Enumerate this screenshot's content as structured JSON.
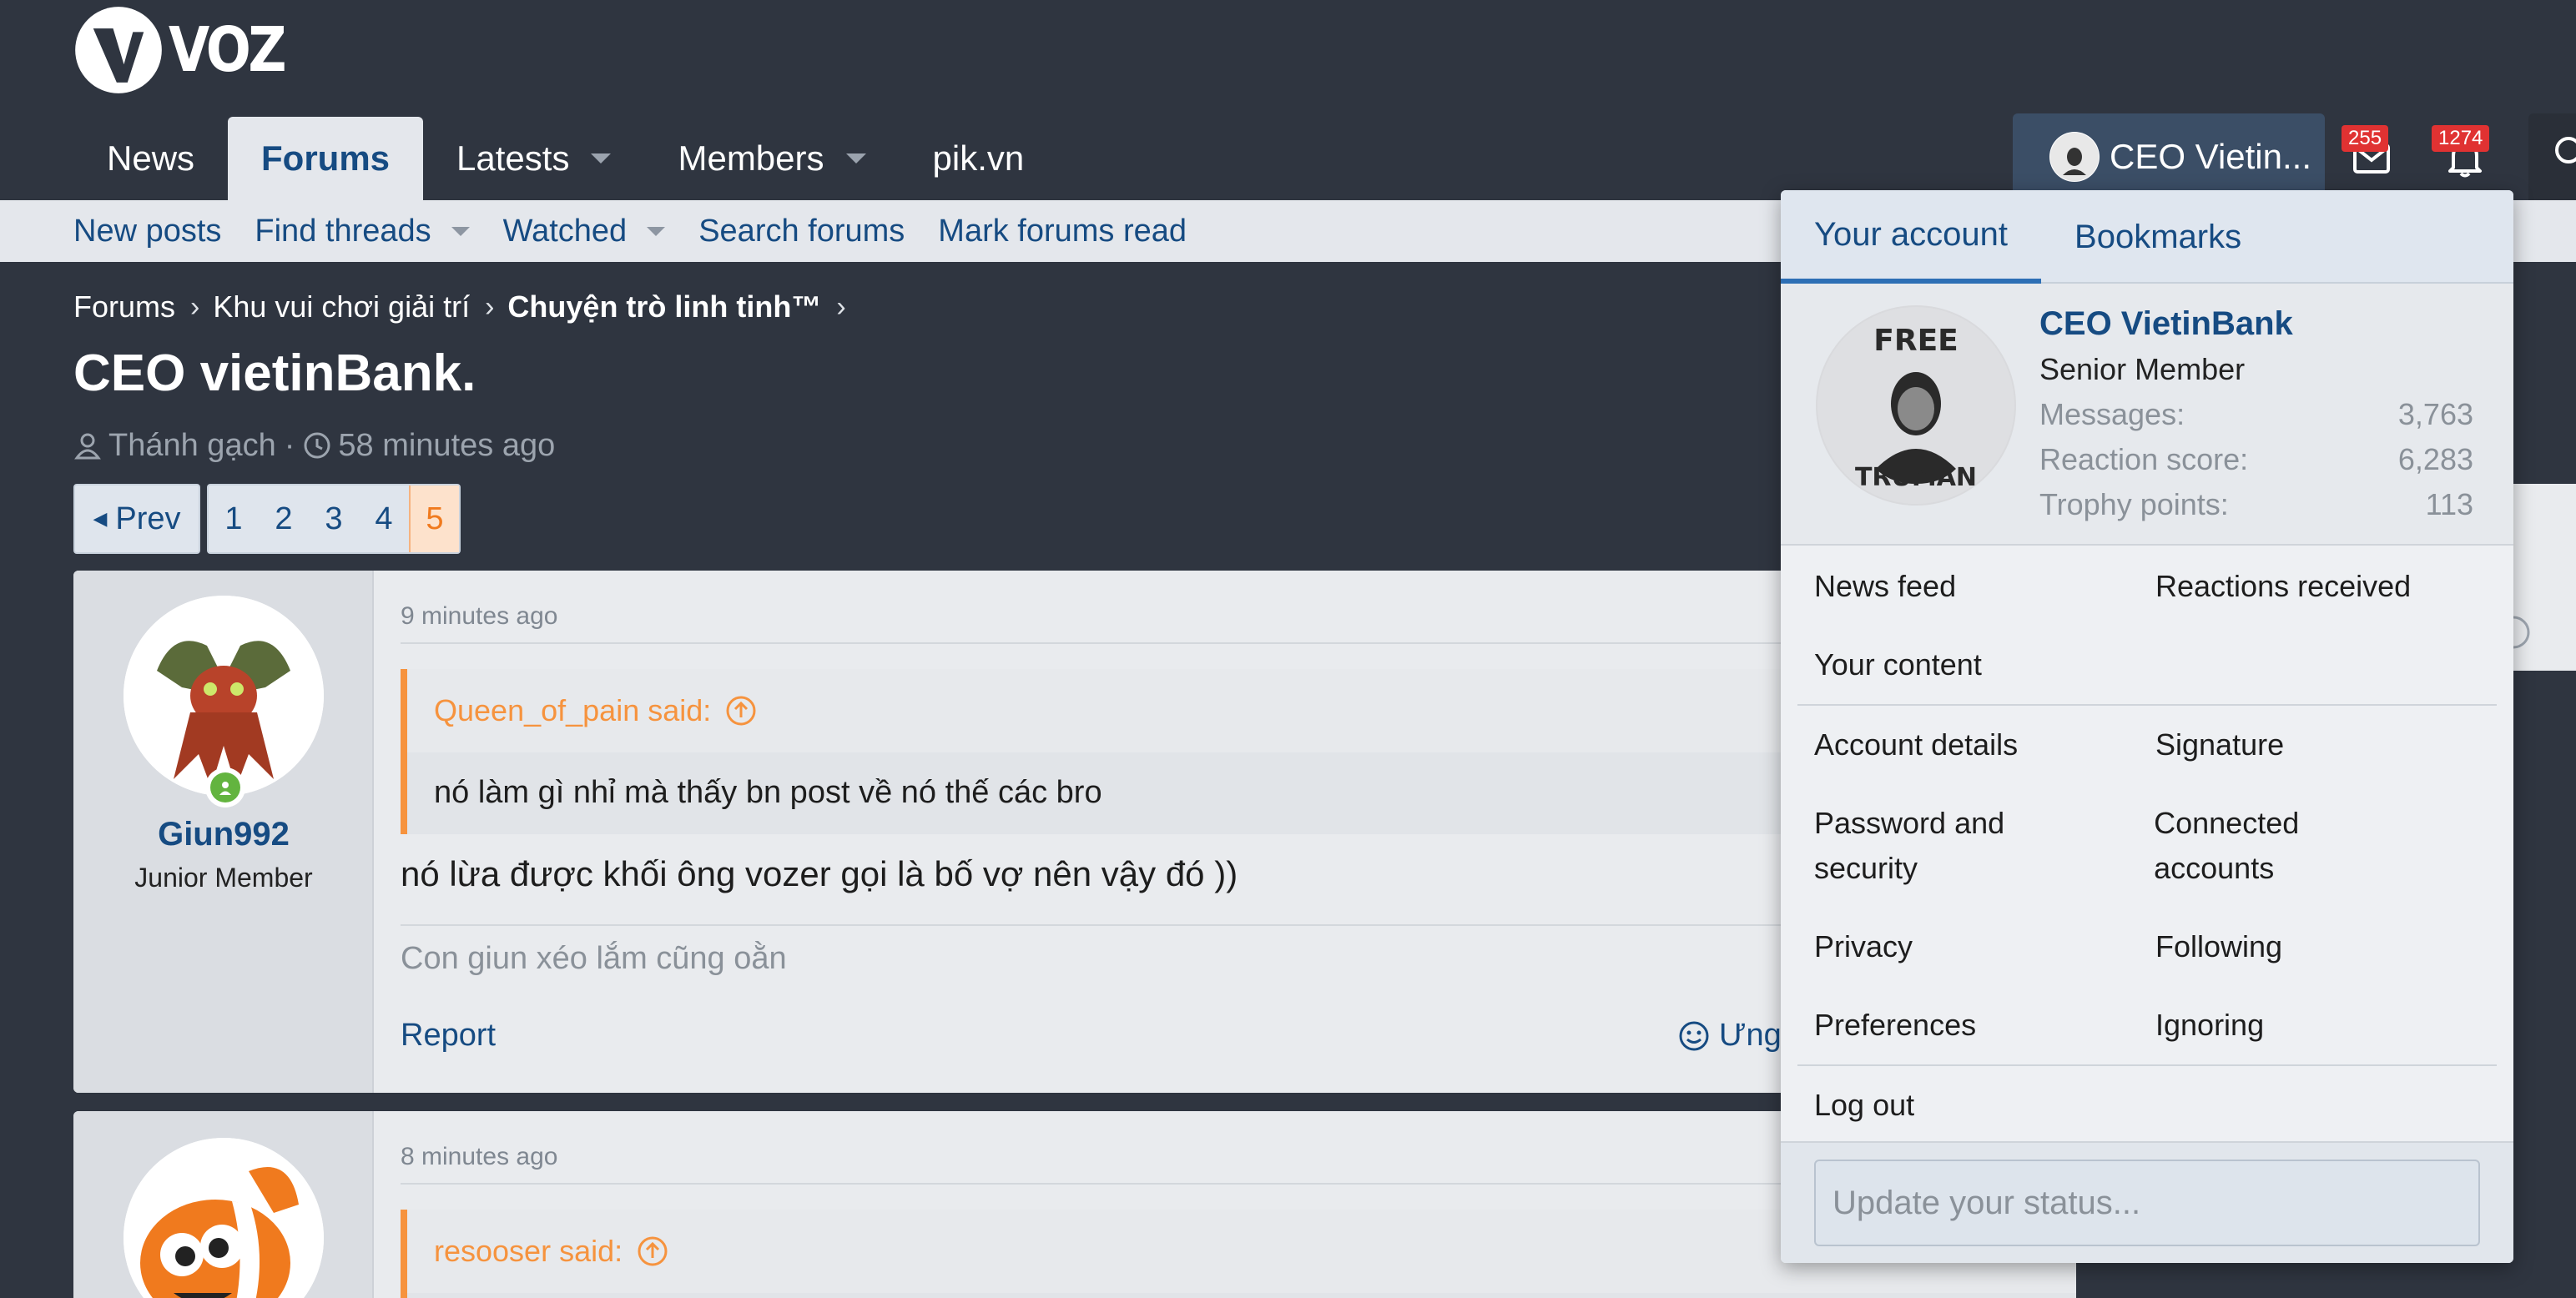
{
  "header": {
    "logo_text": "VOZ",
    "nav": [
      {
        "label": "News"
      },
      {
        "label": "Forums"
      },
      {
        "label": "Latests"
      },
      {
        "label": "Members"
      },
      {
        "label": "pik.vn"
      }
    ],
    "user_link_label": "CEO Vietin...",
    "inbox_count": "255",
    "alerts_count": "1274"
  },
  "subnav": {
    "items": [
      "New posts",
      "Find threads",
      "Watched",
      "Search forums",
      "Mark forums read"
    ]
  },
  "breadcrumb": [
    "Forums",
    "Khu vui chơi giải trí",
    "Chuyện trò linh tinh™"
  ],
  "thread": {
    "title": "CEO vietinBank.",
    "author": "Thánh gạch",
    "age": "58 minutes ago"
  },
  "pagination": {
    "prev_label": "Prev",
    "pages": [
      "1",
      "2",
      "3",
      "4",
      "5"
    ],
    "current": "5"
  },
  "posts": [
    {
      "time": "9 minutes ago",
      "username": "Giun992",
      "user_title": "Junior Member",
      "quote_author": "Queen_of_pain said:",
      "quote_text": "nó làm gì nhỉ mà thấy bn post về nó thế các bro",
      "text": "nó lừa được khối ông vozer gọi là bố vợ nên vậy đó ))",
      "signature": "Con giun xéo lắm cũng oằn",
      "report_label": "Report",
      "react_label": "Ưng"
    },
    {
      "time": "8 minutes ago",
      "quote_author": "resooser said:"
    }
  ],
  "account_menu": {
    "tabs": [
      "Your account",
      "Bookmarks"
    ],
    "name": "CEO VietinBank",
    "rank": "Senior Member",
    "stats": [
      {
        "label": "Messages:",
        "value": "3,763"
      },
      {
        "label": "Reaction score:",
        "value": "6,283"
      },
      {
        "label": "Trophy points:",
        "value": "113"
      }
    ],
    "avatar_text_top": "FREE",
    "avatar_text_bottom": "TRUMAN",
    "links_group1": [
      [
        "News feed",
        "Reactions received"
      ],
      [
        "Your content",
        ""
      ]
    ],
    "links_group2": [
      [
        "Account details",
        "Signature"
      ],
      [
        "Password and security",
        "Connected accounts"
      ],
      [
        "Privacy",
        "Following"
      ],
      [
        "Preferences",
        "Ignoring"
      ]
    ],
    "logout": "Log out",
    "status_placeholder": "Update your status..."
  },
  "colors": {
    "background": "#2f3540",
    "link": "#164b82",
    "accent_orange": "#f6933e",
    "badge_red": "#e03232"
  }
}
